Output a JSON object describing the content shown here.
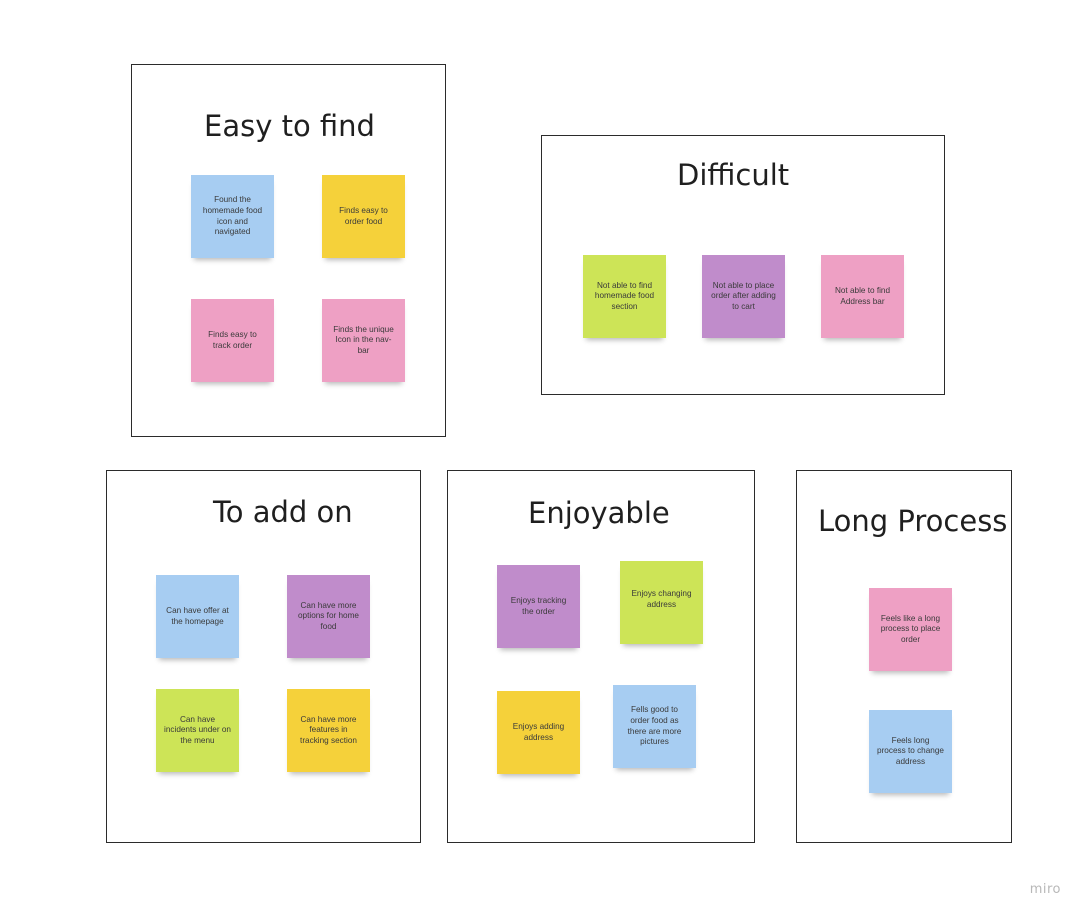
{
  "frames": {
    "easy": {
      "title": "Easy to find",
      "notes": [
        {
          "text": "Found the homemade food icon and navigated",
          "color": "blue"
        },
        {
          "text": "Finds easy to order food",
          "color": "yellow"
        },
        {
          "text": "Finds easy to track order",
          "color": "pink"
        },
        {
          "text": "Finds the unique Icon in the nav-bar",
          "color": "pink"
        }
      ]
    },
    "difficult": {
      "title": "Difficult",
      "notes": [
        {
          "text": "Not able to find homemade food section",
          "color": "green"
        },
        {
          "text": "Not able to place order after adding to cart",
          "color": "purple"
        },
        {
          "text": "Not able to find Address bar",
          "color": "pink"
        }
      ]
    },
    "add_on": {
      "title": "To add on",
      "notes": [
        {
          "text": "Can have offer at the homepage",
          "color": "blue"
        },
        {
          "text": "Can have more options for home food",
          "color": "purple"
        },
        {
          "text": "Can have incidents under on the menu",
          "color": "green"
        },
        {
          "text": "Can have more features in tracking section",
          "color": "yellow"
        }
      ]
    },
    "enjoyable": {
      "title": "Enjoyable",
      "notes": [
        {
          "text": "Enjoys tracking the order",
          "color": "purple"
        },
        {
          "text": "Enjoys changing address",
          "color": "green"
        },
        {
          "text": "Enjoys adding address",
          "color": "yellow"
        },
        {
          "text": "Fells good to order food as there are more pictures",
          "color": "blue"
        }
      ]
    },
    "long_process": {
      "title": "Long Process",
      "notes": [
        {
          "text": "Feels like a long process to place order",
          "color": "pink"
        },
        {
          "text": "Feels long process to change address",
          "color": "blue"
        }
      ]
    }
  },
  "colors": {
    "blue": "#a7cdf2",
    "yellow": "#f5d13a",
    "pink": "#eea0c4",
    "green": "#cde457",
    "purple": "#c08ccb",
    "frame_border": "#2b2b2b"
  },
  "watermark": "miro"
}
